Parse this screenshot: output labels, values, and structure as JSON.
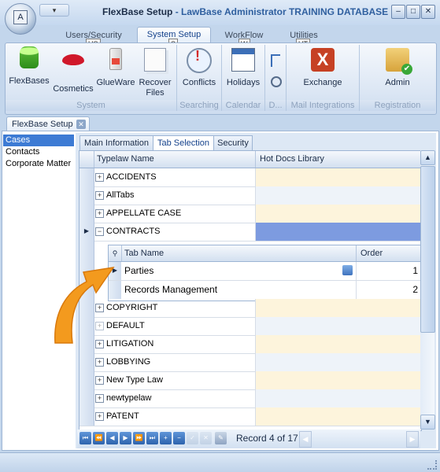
{
  "window": {
    "orb_letter": "A",
    "qat_label": "▾",
    "title_app": "FlexBase Setup",
    "title_separator": " - ",
    "title_db": "LawBase Administrator TRAINING DATABASE",
    "controls": {
      "minimize": "–",
      "maximize": "□",
      "close": "✕"
    }
  },
  "ribbon_tabs": [
    {
      "label": "Users/Security",
      "keytip": "US"
    },
    {
      "label": "System Setup",
      "keytip": "S"
    },
    {
      "label": "WorkFlow",
      "keytip": "W"
    },
    {
      "label": "Utilities",
      "keytip": "UT"
    }
  ],
  "ribbon": {
    "groups": {
      "system": "System",
      "searching": "Searching",
      "calendar": "Calendar",
      "d": "D...",
      "mail": "Mail Integrations",
      "registration": "Registration"
    },
    "buttons": {
      "flexbases": "FlexBases",
      "cosmetics": "Cosmetics",
      "glueware": "GlueWare",
      "recover_files_1": "Recover",
      "recover_files_2": "Files",
      "conflicts": "Conflicts",
      "holidays": "Holidays",
      "exchange": "Exchange",
      "admin": "Admin"
    },
    "exchange_glyph": "X"
  },
  "doc_tab": {
    "label": "FlexBase Setup",
    "close": "✕"
  },
  "left_list": [
    "Cases",
    "Contacts",
    "Corporate Matter"
  ],
  "panel_tabs": [
    "Main Information",
    "Tab Selection",
    "Security"
  ],
  "grid": {
    "columns": [
      "Typelaw Name",
      "Hot Docs Library"
    ],
    "rows_top": [
      "ACCIDENTS",
      "AllTabs",
      "APPELLATE CASE",
      "CONTRACTS"
    ],
    "rows_bottom": [
      "COPYRIGHT",
      "DEFAULT",
      "LITIGATION",
      "LOBBYING",
      "New Type Law",
      "newtypelaw",
      "PATENT"
    ],
    "expand_glyph": "+",
    "collapse_glyph": "−",
    "current_row_glyph": "▶"
  },
  "child_grid": {
    "columns": [
      "Tab Name",
      "Order"
    ],
    "rows": [
      {
        "name": "Parties",
        "order": "1"
      },
      {
        "name": "Records Management",
        "order": "2"
      }
    ]
  },
  "navigator": {
    "record_text": "Record 4 of 17",
    "buttons": [
      "⏮",
      "⏪",
      "◀",
      "▶",
      "⏩",
      "⏭",
      "+",
      "−",
      "✓",
      "✕",
      "✎"
    ]
  },
  "scroll": {
    "up": "▲",
    "down": "▼"
  },
  "colors": {
    "accent": "#15428b",
    "hot_docs_cell": "#fdf4dc",
    "selected_hot_cell": "#7d9be0",
    "arrow": "#f39a1e"
  }
}
